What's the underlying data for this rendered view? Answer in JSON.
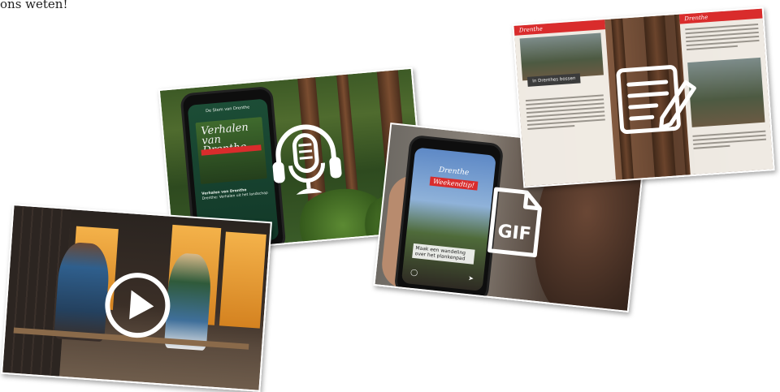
{
  "caption": "ons weten!",
  "podcast_card": {
    "screen_header": "De Stem van Drenthe",
    "artwork_title": "Verhalen van Drenthe",
    "episode_title": "Verhalen van Drenthe",
    "episode_meta": "Drenthe: Verhalen uit het landschap",
    "icon": "microphone-headphones-icon"
  },
  "gif_card": {
    "logo": "Drenthe",
    "tag": "Weekendtip!",
    "text_box": "Maak een wandeling over het plankenpad",
    "icon_text": "GIF",
    "icon": "gif-file-icon"
  },
  "article_card": {
    "page_logo_left": "Drenthe",
    "page_logo_right": "Drenthe",
    "banner": "In Drenthes bossen",
    "icon": "document-pencil-icon"
  },
  "video_card": {
    "icon": "play-icon"
  },
  "colors": {
    "brand_red": "#d92c2c",
    "icon_white": "#ffffff"
  }
}
